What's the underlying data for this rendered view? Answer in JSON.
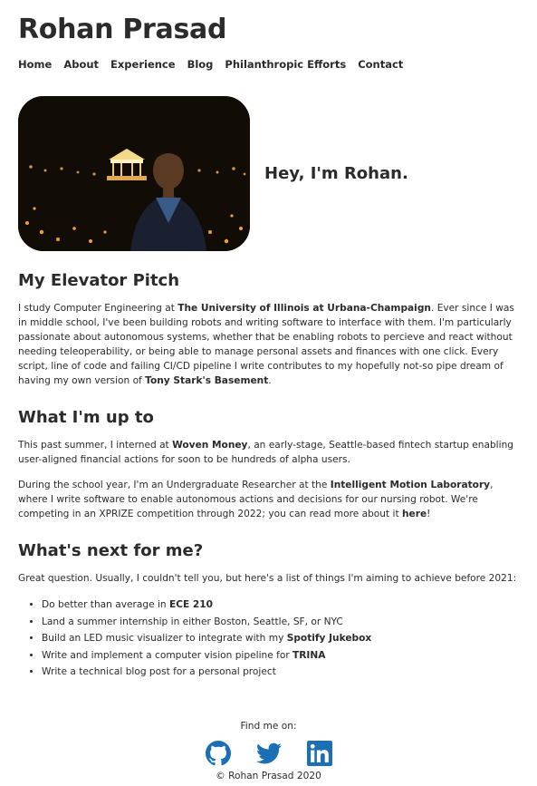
{
  "site": {
    "title": "Rohan Prasad"
  },
  "nav": {
    "items": [
      "Home",
      "About",
      "Experience",
      "Blog",
      "Philanthropic Efforts",
      "Contact"
    ]
  },
  "hero": {
    "greeting": "Hey, I'm Rohan."
  },
  "pitch": {
    "heading": "My Elevator Pitch",
    "t1": "I study Computer Engineering at ",
    "b1": "The University of Illinois at Urbana-Champaign",
    "t2": ". Ever since I was in middle school, I've been building robots and writing software to interface with them. I'm particularly passionate about autonomous systems, whether that be enabling robots to percieve and react without needing teleoperability, or being able to manage personal assets and finances with one click. Every script, line of code and failing CI/CD pipeline I write contributes to my hopefully not-so pipe dream of having my own version of ",
    "b2": "Tony Stark's Basement",
    "t3": "."
  },
  "upto": {
    "heading": "What I'm up to",
    "p1_t1": "This past summer, I interned at ",
    "p1_b1": "Woven Money",
    "p1_t2": ", an early-stage, Seattle-based fintech startup enabling user-aligned financial actions for soon to be hundreds of alpha users.",
    "p2_t1": "During the school year, I'm an Undergraduate Researcher at the ",
    "p2_b1": "Intelligent Motion Laboratory",
    "p2_t2": ", where I write software to enable autonomous actions and decisions for our nursing robot. We're competing in an XPRIZE competition through 2022; you can read more about it ",
    "p2_b2": "here",
    "p2_t3": "!"
  },
  "next": {
    "heading": "What's next for me?",
    "intro": "Great question. Usually, I couldn't tell you, but here's a list of things I'm aiming to achieve before 2021:",
    "items": [
      {
        "t": "Do better than average in ",
        "b": "ECE 210"
      },
      {
        "t": "Land a summer internship in either Boston, Seattle, SF, or NYC",
        "b": ""
      },
      {
        "t": "Build an LED music visualizer to integrate with my ",
        "b": "Spotify Jukebox"
      },
      {
        "t": "Write and implement a computer vision pipeline for ",
        "b": "TRINA"
      },
      {
        "t": "Write a technical blog post for a personal project",
        "b": ""
      }
    ]
  },
  "footer": {
    "find_me": "Find me on:",
    "icons": [
      "github-icon",
      "twitter-icon",
      "linkedin-icon"
    ],
    "copyright": "© Rohan Prasad 2020"
  },
  "colors": {
    "text": "#2b2b2b",
    "github": "#1b6fb5",
    "twitter": "#1da1f2",
    "linkedin": "#0a66c2"
  }
}
